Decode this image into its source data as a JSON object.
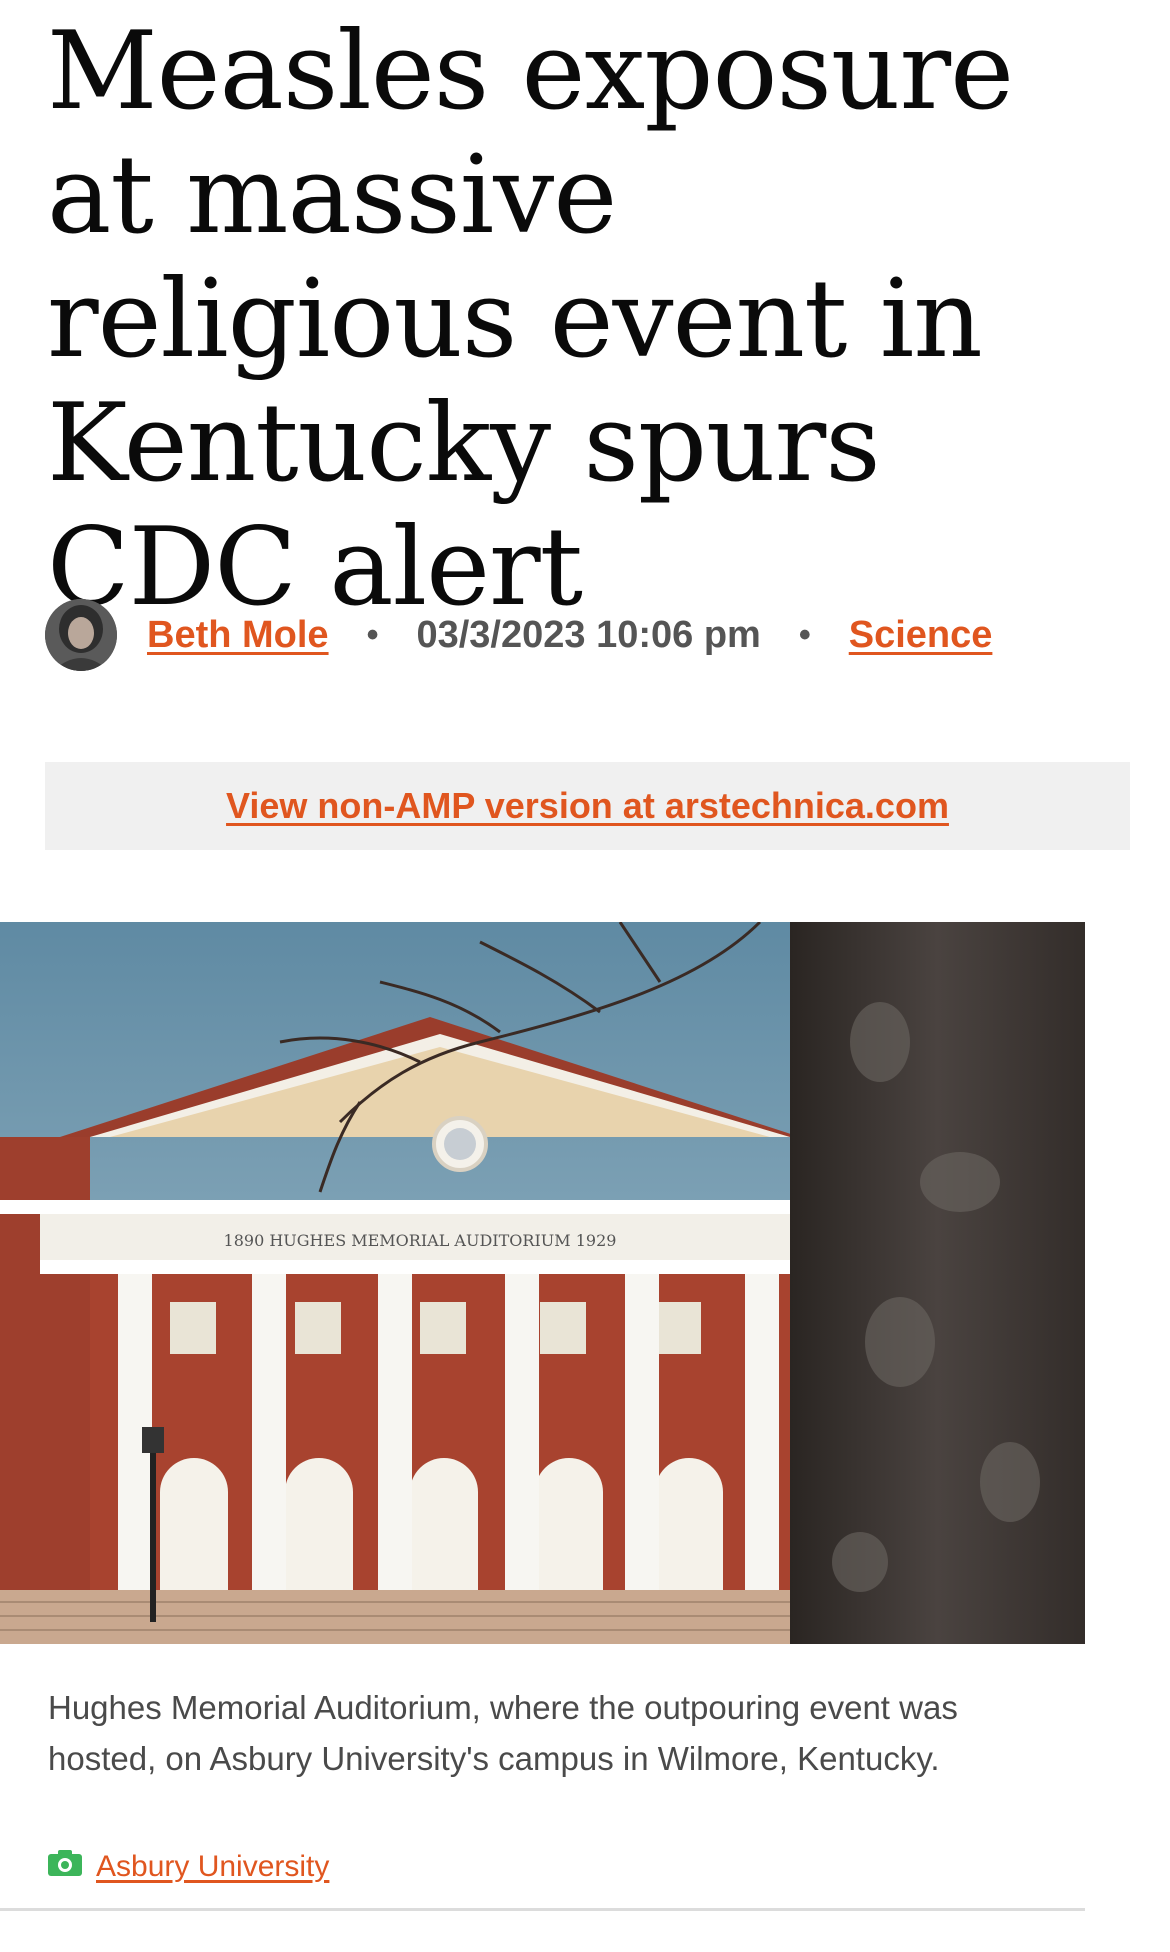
{
  "article": {
    "headline": "Measles exposure at massive religious event in Kentucky spurs CDC alert",
    "author": "Beth Mole",
    "timestamp": "03/3/2023 10:06 pm",
    "category": "Science",
    "separator": "•"
  },
  "amp_link": "View non-AMP version at arstechnica.com",
  "image": {
    "building_inscription": "1890   HUGHES   MEMORIAL   AUDITORIUM   1929",
    "caption": "Hughes Memorial Auditorium, where the outpouring event was hosted, on Asbury University's campus in Wilmore, Kentucky.",
    "credit": "Asbury University",
    "credit_icon": "camera-icon"
  },
  "colors": {
    "accent": "#e0561f",
    "meta_gray": "#555555",
    "bar_bg": "#f0f0f0",
    "credit_icon": "#3cb55a"
  }
}
